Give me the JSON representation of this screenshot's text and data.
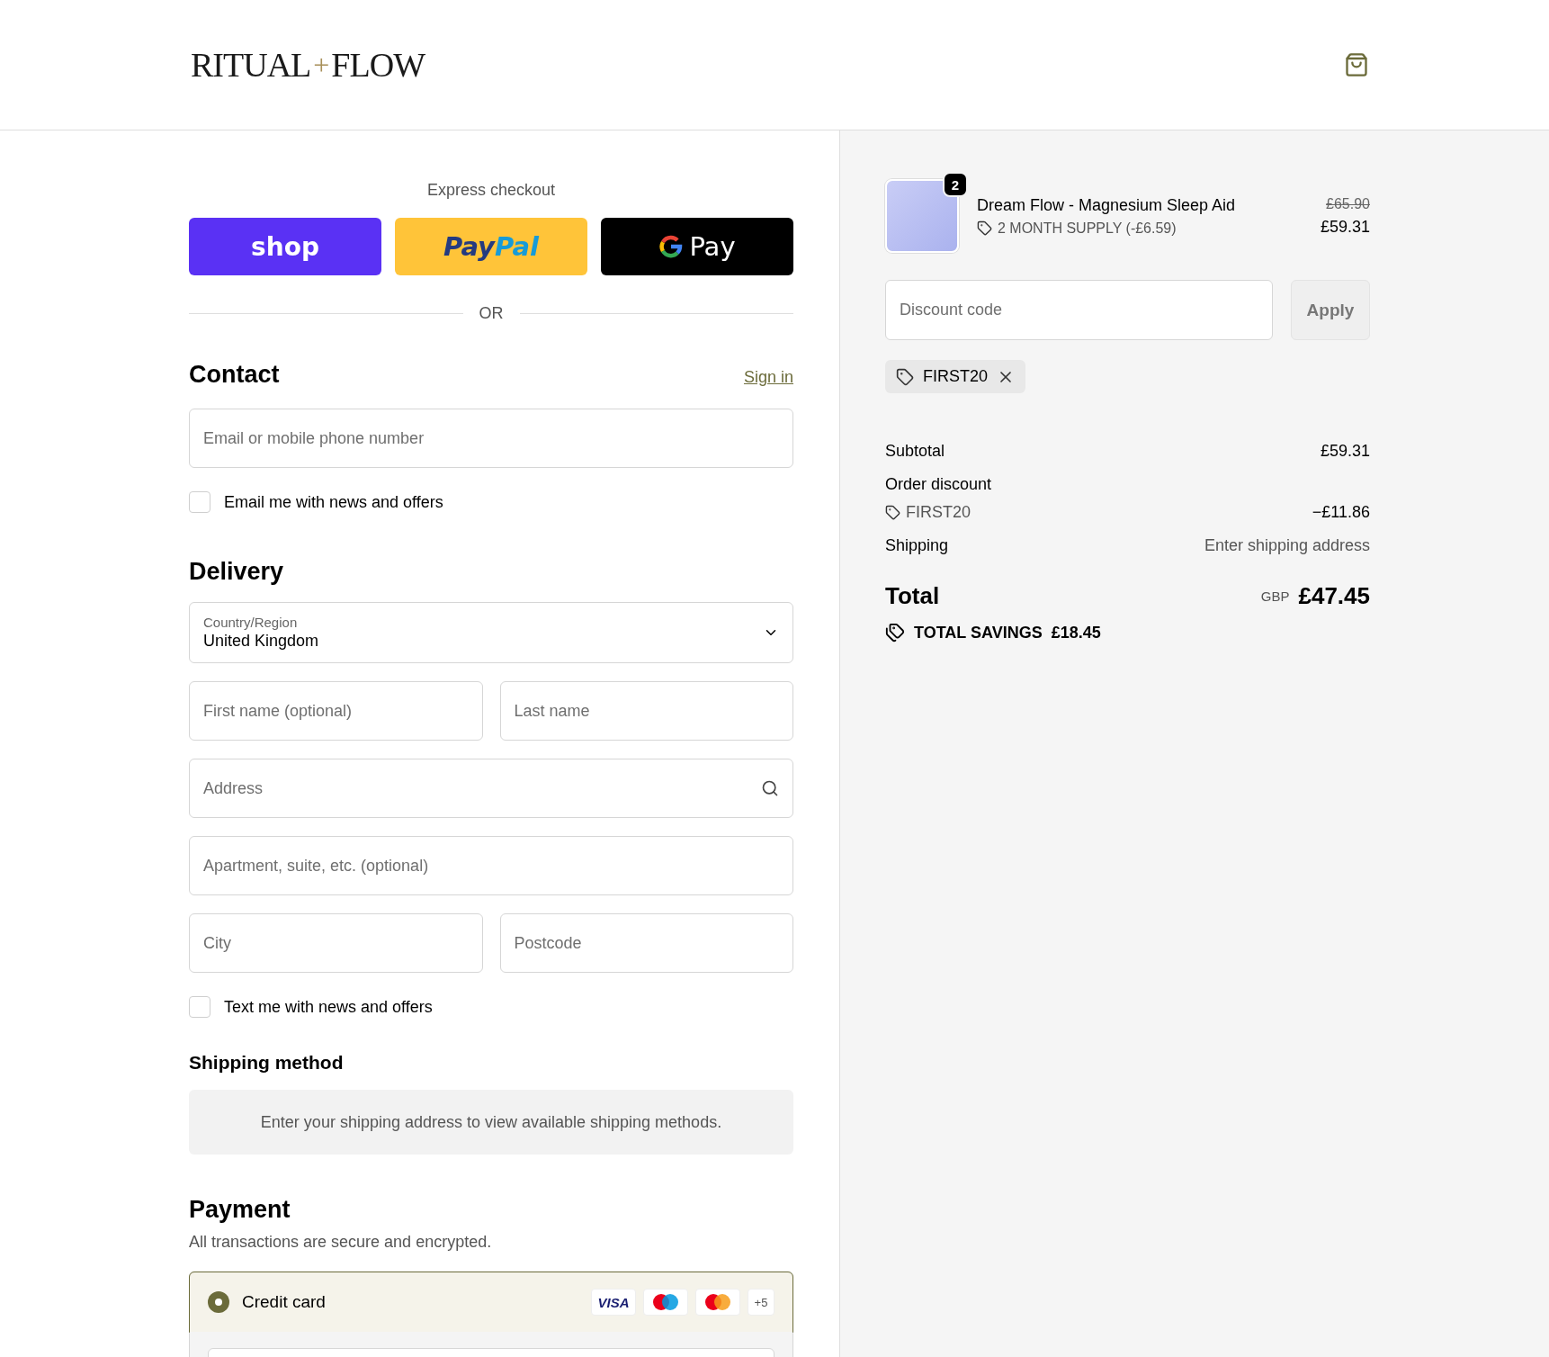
{
  "header": {
    "logo": {
      "left": "RITUAL",
      "plus": "+",
      "right": "FLOW"
    }
  },
  "express_checkout": {
    "title": "Express checkout",
    "buttons": [
      {
        "kind": "shop",
        "label": "shop"
      },
      {
        "kind": "paypal",
        "label": "Pay",
        "label_2": "Pal"
      },
      {
        "kind": "gpay",
        "label": "Pay"
      }
    ],
    "divider": "OR"
  },
  "contact": {
    "title": "Contact",
    "sign_in": "Sign in",
    "email": {
      "placeholder": "Email or mobile phone number"
    },
    "news": {
      "label": "Email me with news and offers",
      "checked": false
    }
  },
  "delivery": {
    "title": "Delivery",
    "country": {
      "label": "Country/Region",
      "value": "United Kingdom"
    },
    "rows": [
      [
        {
          "kind": "text",
          "placeholder": "First name (optional)"
        },
        {
          "kind": "text",
          "placeholder": "Last name"
        }
      ],
      [
        {
          "kind": "search",
          "placeholder": "Address"
        }
      ],
      [
        {
          "kind": "text",
          "placeholder": "Apartment, suite, etc. (optional)"
        }
      ],
      [
        {
          "kind": "text",
          "placeholder": "City"
        },
        {
          "kind": "text",
          "placeholder": "Postcode"
        }
      ]
    ],
    "sms": {
      "label": "Text me with news and offers",
      "checked": false
    }
  },
  "shipping_method": {
    "title": "Shipping method",
    "notice": "Enter your shipping address to view available shipping methods."
  },
  "payment": {
    "title": "Payment",
    "note": "All transactions are secure and encrypted.",
    "methods": [
      {
        "label": "Credit card",
        "selected": true,
        "cards": [
          {
            "kind": "visa",
            "label": "VISA"
          },
          {
            "kind": "maestro"
          },
          {
            "kind": "mastercard"
          },
          {
            "kind": "more",
            "label": "+5"
          }
        ]
      }
    ]
  },
  "summary": {
    "item": {
      "quantity": "2",
      "name": "Dream Flow - Magnesium Sleep Aid",
      "variant": "2 MONTH SUPPLY (-£6.59)",
      "original_price": "£65.90",
      "price": "£59.31"
    },
    "discount": {
      "placeholder": "Discount code",
      "button": "Apply",
      "disabled": true
    },
    "applied_codes": [
      {
        "code": "FIRST20"
      }
    ],
    "lines": [
      {
        "kind": "plain",
        "label": "Subtotal",
        "value": "£59.31"
      },
      {
        "kind": "heading",
        "label": "Order discount"
      },
      {
        "kind": "code",
        "label": "FIRST20",
        "value": "−£11.86"
      },
      {
        "kind": "muted",
        "label": "Shipping",
        "value": "Enter shipping address"
      }
    ],
    "total": {
      "label": "Total",
      "currency": "GBP",
      "value": "£47.45"
    },
    "savings": {
      "label": "TOTAL SAVINGS",
      "value": "£18.45"
    }
  }
}
